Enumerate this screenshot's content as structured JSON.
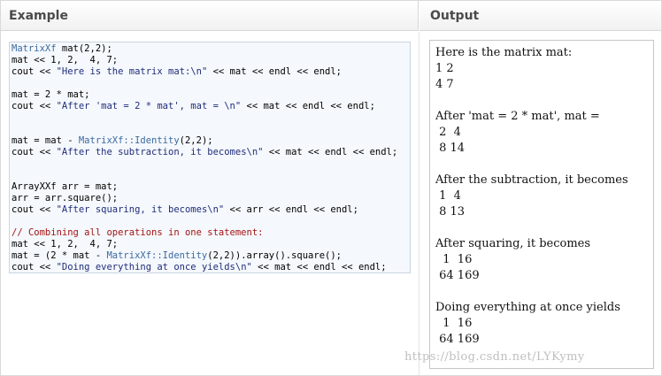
{
  "panels": {
    "example_title": "Example",
    "output_title": "Output"
  },
  "code": {
    "lines": [
      [
        {
          "t": "type",
          "s": "MatrixXf"
        },
        {
          "t": "plain",
          "s": " mat(2,2);"
        }
      ],
      [
        {
          "t": "plain",
          "s": "mat << 1, 2,  4, 7;"
        }
      ],
      [
        {
          "t": "plain",
          "s": "cout << "
        },
        {
          "t": "str",
          "s": "\"Here is the matrix mat:\\n\""
        },
        {
          "t": "plain",
          "s": " << mat << endl << endl;"
        }
      ],
      [
        {
          "t": "plain",
          "s": ""
        }
      ],
      [
        {
          "t": "plain",
          "s": "mat = 2 * mat;"
        }
      ],
      [
        {
          "t": "plain",
          "s": "cout << "
        },
        {
          "t": "str",
          "s": "\"After 'mat = 2 * mat', mat = \\n\""
        },
        {
          "t": "plain",
          "s": " << mat << endl << endl;"
        }
      ],
      [
        {
          "t": "plain",
          "s": ""
        }
      ],
      [
        {
          "t": "plain",
          "s": ""
        }
      ],
      [
        {
          "t": "plain",
          "s": "mat = mat - "
        },
        {
          "t": "type",
          "s": "MatrixXf::Identity"
        },
        {
          "t": "plain",
          "s": "(2,2);"
        }
      ],
      [
        {
          "t": "plain",
          "s": "cout << "
        },
        {
          "t": "str",
          "s": "\"After the subtraction, it becomes\\n\""
        },
        {
          "t": "plain",
          "s": " << mat << endl << endl;"
        }
      ],
      [
        {
          "t": "plain",
          "s": ""
        }
      ],
      [
        {
          "t": "plain",
          "s": ""
        }
      ],
      [
        {
          "t": "plain",
          "s": "ArrayXXf arr = mat;"
        }
      ],
      [
        {
          "t": "plain",
          "s": "arr = arr.square();"
        }
      ],
      [
        {
          "t": "plain",
          "s": "cout << "
        },
        {
          "t": "str",
          "s": "\"After squaring, it becomes\\n\""
        },
        {
          "t": "plain",
          "s": " << arr << endl << endl;"
        }
      ],
      [
        {
          "t": "plain",
          "s": ""
        }
      ],
      [
        {
          "t": "comment",
          "s": "// Combining all operations in one statement:"
        }
      ],
      [
        {
          "t": "plain",
          "s": "mat << 1, 2,  4, 7;"
        }
      ],
      [
        {
          "t": "plain",
          "s": "mat = (2 * mat - "
        },
        {
          "t": "type",
          "s": "MatrixXf::Identity"
        },
        {
          "t": "plain",
          "s": "(2,2)).array().square();"
        }
      ],
      [
        {
          "t": "plain",
          "s": "cout << "
        },
        {
          "t": "str",
          "s": "\"Doing everything at once yields\\n\""
        },
        {
          "t": "plain",
          "s": " << mat << endl << endl;"
        }
      ]
    ]
  },
  "output": {
    "text": "Here is the matrix mat:\n1 2\n4 7\n\nAfter 'mat = 2 * mat', mat =\n 2  4\n 8 14\n\nAfter the subtraction, it becomes\n 1  4\n 8 13\n\nAfter squaring, it becomes\n  1  16\n 64 169\n\nDoing everything at once yields\n  1  16\n 64 169"
  },
  "watermark": "https://blog.csdn.net/LYKymy",
  "colors": {
    "type": "#3b6aa0",
    "string": "#1f2d7a",
    "comment": "#a31515"
  }
}
